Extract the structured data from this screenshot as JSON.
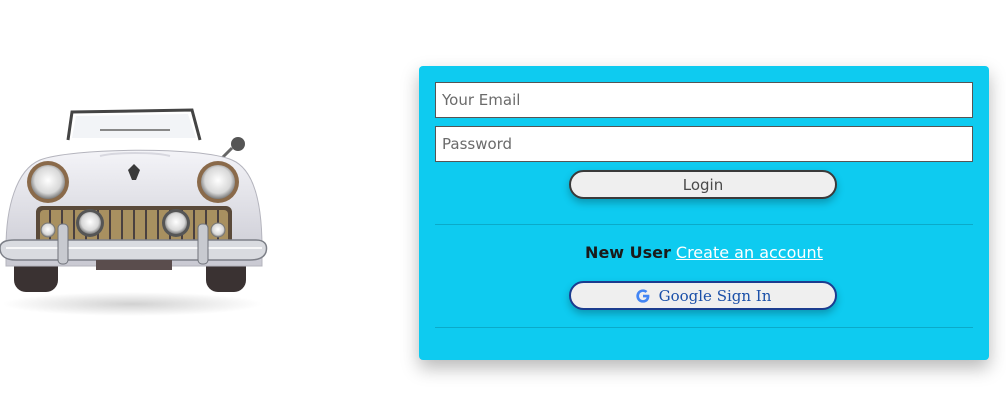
{
  "login_form": {
    "email_placeholder": "Your Email",
    "password_placeholder": "Password",
    "login_label": "Login",
    "new_user_label": "New User",
    "create_account_label": "Create an account",
    "google_sign_in_label": "Google Sign In"
  },
  "colors": {
    "card_background": "#0ecbf0",
    "google_blue": "#4285f4",
    "link_color": "#ffffff"
  },
  "icons": {
    "google": "google-g-icon",
    "hero": "vintage-convertible-car"
  }
}
